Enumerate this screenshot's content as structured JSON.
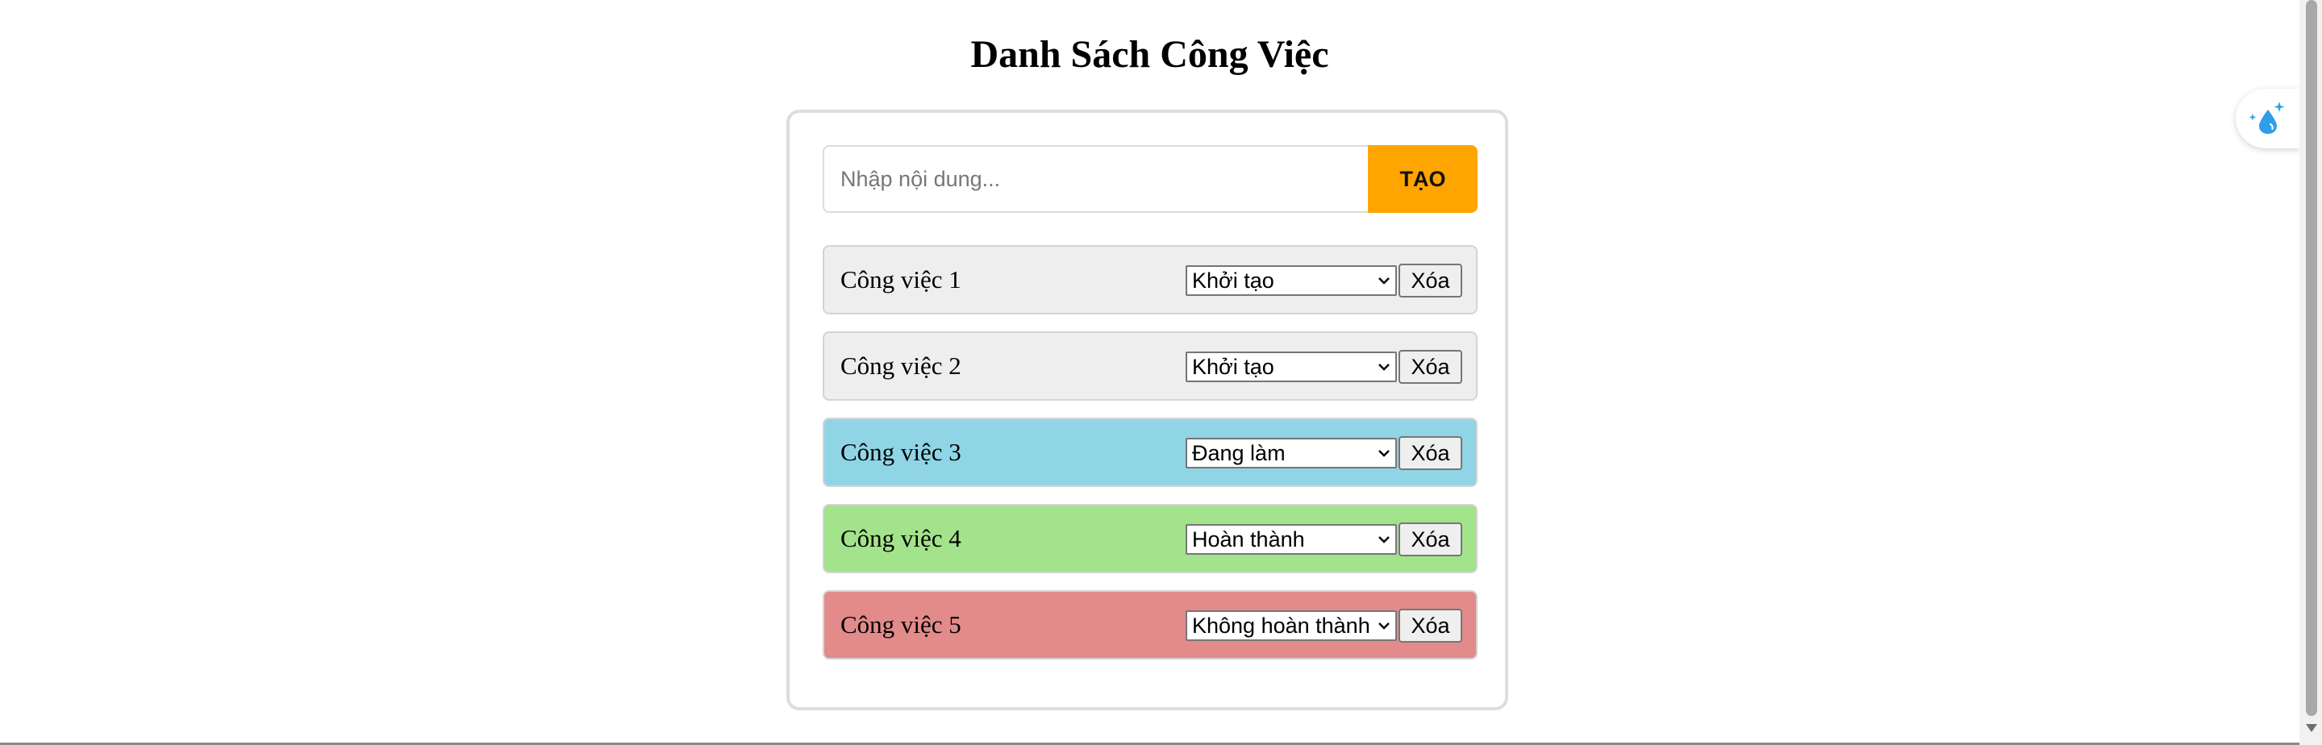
{
  "title": "Danh Sách Công Việc",
  "form": {
    "placeholder": "Nhập nội dung...",
    "value": "",
    "create_label": "TẠO"
  },
  "tasks": [
    {
      "name": "Công việc 1",
      "status": "Khởi tạo",
      "delete_label": "Xóa",
      "bg_color": "#eeeeee"
    },
    {
      "name": "Công việc 2",
      "status": "Khởi tạo",
      "delete_label": "Xóa",
      "bg_color": "#eeeeee"
    },
    {
      "name": "Công việc 3",
      "status": "Đang làm",
      "delete_label": "Xóa",
      "bg_color": "#8fd5e6"
    },
    {
      "name": "Công việc 4",
      "status": "Hoàn thành",
      "delete_label": "Xóa",
      "bg_color": "#a3e38b"
    },
    {
      "name": "Công việc 5",
      "status": "Không hoàn thành",
      "delete_label": "Xóa",
      "bg_color": "#e28b8a"
    }
  ],
  "colors": {
    "accent": "#ffa500",
    "card_border": "#dddddd"
  },
  "widget": {
    "icon": "droplet-sparkle-icon"
  }
}
